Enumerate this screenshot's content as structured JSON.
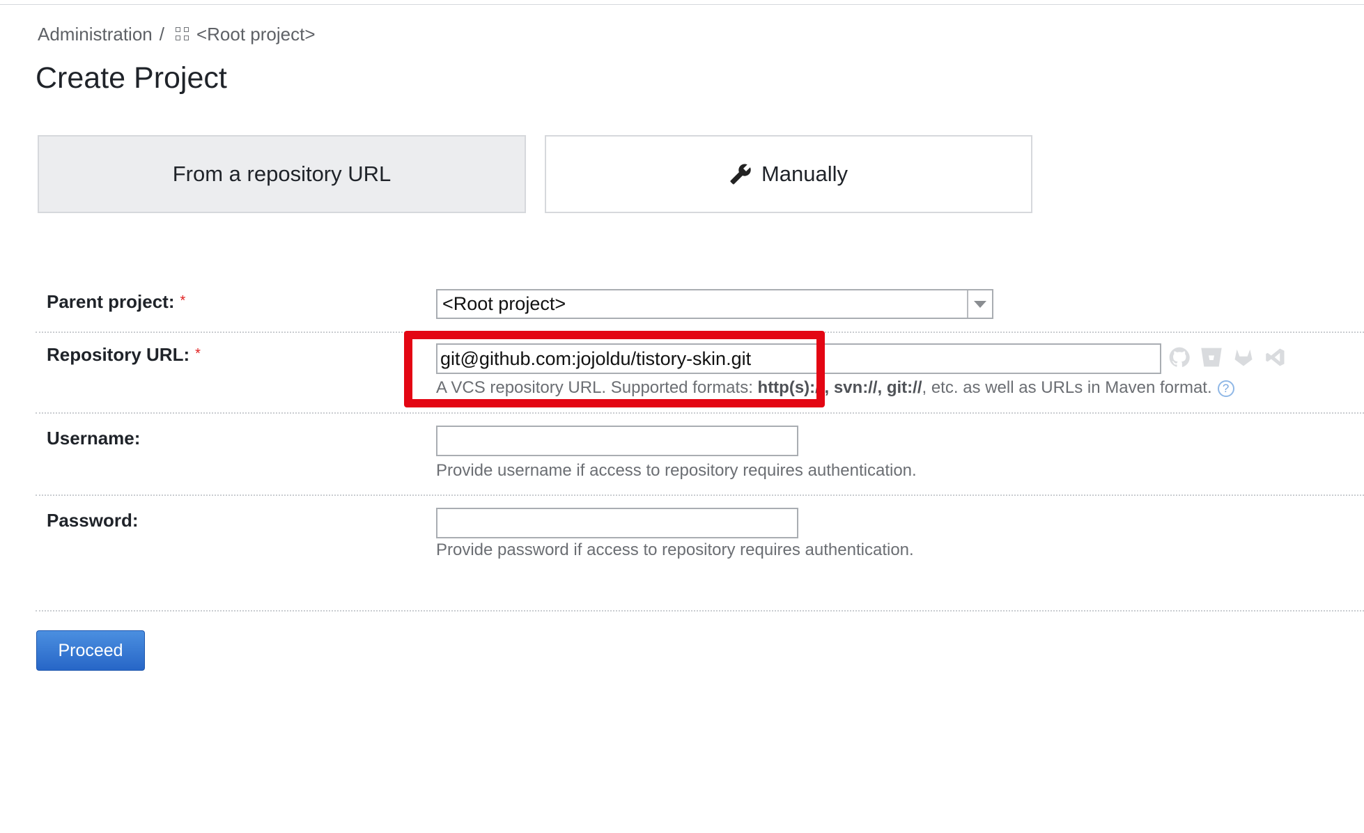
{
  "breadcrumb": {
    "admin": "Administration",
    "separator": "/",
    "project": "<Root project>"
  },
  "page": {
    "title": "Create Project"
  },
  "methods": {
    "repo": "From a repository URL",
    "manual": "Manually"
  },
  "form": {
    "parent": {
      "label": "Parent project:",
      "required": "*",
      "value": "<Root project>"
    },
    "repo_url": {
      "label": "Repository URL:",
      "required": "*",
      "value": "git@github.com:jojoldu/tistory-skin.git",
      "hint_prefix": "A VCS repository URL. Supported formats: ",
      "hint_formats": "http(s)://, svn://, git://",
      "hint_suffix": ", etc. as well as URLs in Maven format.",
      "help": "?"
    },
    "username": {
      "label": "Username:",
      "value": "",
      "hint": "Provide username if access to repository requires authentication."
    },
    "password": {
      "label": "Password:",
      "value": "",
      "hint": "Provide password if access to repository requires authentication."
    },
    "proceed": "Proceed"
  },
  "icons": {
    "breadcrumb": "project-grid-icon",
    "manual": "wrench-icon",
    "vcs": [
      "github-icon",
      "bitbucket-icon",
      "gitlab-icon",
      "azure-devops-icon"
    ]
  },
  "colors": {
    "primary_button": "#2766c7",
    "highlight": "#e30613",
    "required": "#e02020",
    "selected_tab": "#ecedef"
  }
}
